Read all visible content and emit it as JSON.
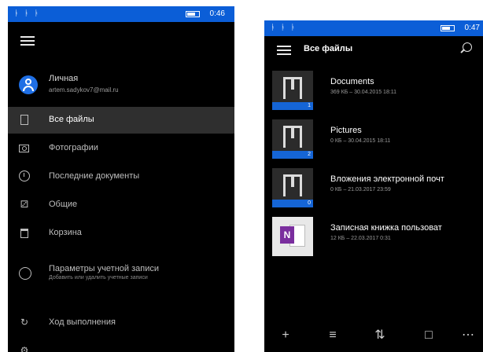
{
  "left_phone": {
    "status": {
      "signal": "ᚭ ᚭ ᚭ",
      "time": "0:46"
    },
    "account": {
      "name": "Личная",
      "email": "artem.sadykov7@mail.ru"
    },
    "nav": [
      {
        "label": "Все файлы",
        "icon": "file-icon",
        "selected": true
      },
      {
        "label": "Фотографии",
        "icon": "photo-icon"
      },
      {
        "label": "Последние документы",
        "icon": "clock-icon"
      },
      {
        "label": "Общие",
        "icon": "shared-icon"
      },
      {
        "label": "Корзина",
        "icon": "trash-icon"
      },
      {
        "label": "Параметры учетной записи",
        "sub": "Добавить или удалить учетные записи",
        "icon": "account-settings-icon"
      },
      {
        "label": "Ход выполнения",
        "icon": "progress-icon"
      }
    ]
  },
  "right_phone": {
    "status": {
      "signal": "ᚭ ᚭ ᚭ",
      "time": "0:47"
    },
    "title": "Все файлы",
    "files": [
      {
        "name": "Documents",
        "meta": "369 КБ – 30.04.2015 18:11",
        "count": "1",
        "type": "folder"
      },
      {
        "name": "Pictures",
        "meta": "0 КБ – 30.04.2015 18:11",
        "count": "2",
        "type": "folder"
      },
      {
        "name": "Вложения электронной почт",
        "meta": "0 КБ – 21.03.2017 23:59",
        "count": "0",
        "type": "folder"
      },
      {
        "name": "Записная книжка пользоват",
        "meta": "12 КБ – 22.03.2017 0:31",
        "type": "onenote"
      }
    ],
    "appbar": [
      "add-icon",
      "select-icon",
      "sort-icon",
      "view-icon",
      "more-icon"
    ],
    "onenote_letter": "N"
  },
  "colors": {
    "accent": "#1565d6",
    "status_bar": "#0b5ed7",
    "background": "#000000",
    "selected": "#2f2f2f"
  }
}
